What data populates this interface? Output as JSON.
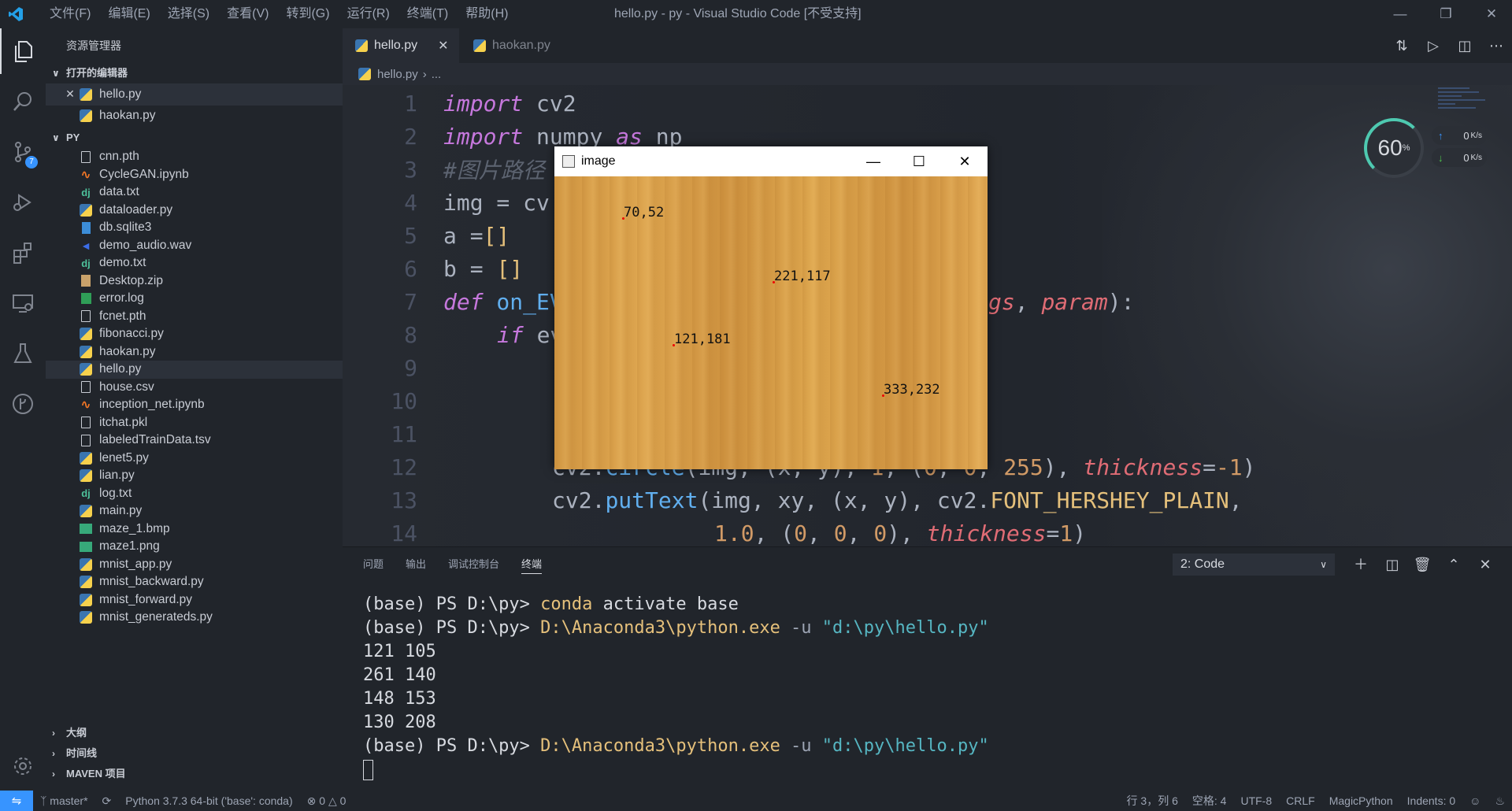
{
  "window": {
    "title": "hello.py - py - Visual Studio Code [不受支持]",
    "menu": [
      "文件(F)",
      "编辑(E)",
      "选择(S)",
      "查看(V)",
      "转到(G)",
      "运行(R)",
      "终端(T)",
      "帮助(H)"
    ],
    "logo_icon": "vscode-logo-icon"
  },
  "activity_bar": {
    "scm_badge": "7",
    "icons": [
      "explorer-icon",
      "search-icon",
      "source-control-icon",
      "run-debug-icon",
      "extensions-icon",
      "remote-explorer-icon",
      "testing-icon",
      "gitlens-icon",
      "settings-gear-icon"
    ]
  },
  "sidebar": {
    "title": "资源管理器",
    "open_editors": {
      "label": "打开的编辑器",
      "items": [
        "hello.py",
        "haokan.py"
      ]
    },
    "folder": {
      "label": "PY",
      "files": [
        {
          "name": "cnn.pth",
          "type": "doc"
        },
        {
          "name": "CycleGAN.ipynb",
          "type": "notebook"
        },
        {
          "name": "data.txt",
          "type": "dj"
        },
        {
          "name": "dataloader.py",
          "type": "py"
        },
        {
          "name": "db.sqlite3",
          "type": "db"
        },
        {
          "name": "demo_audio.wav",
          "type": "wav"
        },
        {
          "name": "demo.txt",
          "type": "dj"
        },
        {
          "name": "Desktop.zip",
          "type": "zip"
        },
        {
          "name": "error.log",
          "type": "log"
        },
        {
          "name": "fcnet.pth",
          "type": "doc"
        },
        {
          "name": "fibonacci.py",
          "type": "py"
        },
        {
          "name": "haokan.py",
          "type": "py"
        },
        {
          "name": "hello.py",
          "type": "py"
        },
        {
          "name": "house.csv",
          "type": "doc"
        },
        {
          "name": "inception_net.ipynb",
          "type": "notebook"
        },
        {
          "name": "itchat.pkl",
          "type": "doc"
        },
        {
          "name": "labeledTrainData.tsv",
          "type": "doc"
        },
        {
          "name": "lenet5.py",
          "type": "py"
        },
        {
          "name": "lian.py",
          "type": "py"
        },
        {
          "name": "log.txt",
          "type": "dj"
        },
        {
          "name": "main.py",
          "type": "py"
        },
        {
          "name": "maze_1.bmp",
          "type": "img"
        },
        {
          "name": "maze1.png",
          "type": "img"
        },
        {
          "name": "mnist_app.py",
          "type": "py"
        },
        {
          "name": "mnist_backward.py",
          "type": "py"
        },
        {
          "name": "mnist_forward.py",
          "type": "py"
        },
        {
          "name": "mnist_generateds.py",
          "type": "py"
        }
      ]
    },
    "outline_label": "大纲",
    "timeline_label": "时间线",
    "maven_label": "MAVEN 项目"
  },
  "tabs": [
    {
      "label": "hello.py",
      "active": true
    },
    {
      "label": "haokan.py",
      "active": false
    }
  ],
  "breadcrumb": {
    "file": "hello.py",
    "rest": "..."
  },
  "editor": {
    "line_numbers": [
      "1",
      "2",
      "3",
      "4",
      "5",
      "6",
      "7",
      "8",
      "9",
      "10",
      "11",
      "12",
      "13",
      "14"
    ],
    "visible_code": {
      "l1_kw": "import",
      "l1_rest": " cv2",
      "l2_kw": "import",
      "l2_mid": " numpy ",
      "l2_as": "as",
      "l2_rest": " np",
      "l3": "#图片路径",
      "l4": "img = cv",
      "l5_a": "a =",
      "l5_b": "[]",
      "l6_a": "b = ",
      "l6_b": "[]",
      "l7_kw": "def",
      "l7_fn": " on_EV",
      "l7_tail_par1": "gs",
      "l7_tail_mid": ", ",
      "l7_tail_par2": "param",
      "l7_tail_end": "):",
      "l8_kw": "if",
      "l8_rest": " ev",
      "l12_a": "cv2.",
      "l12_fn": "circle",
      "l12_b": "(img, (x, y), ",
      "l12_n1": "1",
      "l12_c": ", (",
      "l12_n2": "0",
      "l12_d": ", ",
      "l12_n3": "0",
      "l12_e": ", ",
      "l12_n4": "255",
      "l12_f": "), ",
      "l12_par": "thickness",
      "l12_g": "=",
      "l12_n5": "-1",
      "l12_h": ")",
      "l13_a": "cv2.",
      "l13_fn": "putText",
      "l13_b": "(img, xy, (x, y), cv2.",
      "l13_cls": "FONT_HERSHEY_PLAIN",
      "l13_c": ",",
      "l14_n1": "1.0",
      "l14_a": ", (",
      "l14_n2": "0",
      "l14_b": ", ",
      "l14_n3": "0",
      "l14_c": ", ",
      "l14_n4": "0",
      "l14_d": "), ",
      "l14_par": "thickness",
      "l14_e": "=",
      "l14_n5": "1",
      "l14_f": ")"
    }
  },
  "speed_widget": {
    "percent": "60",
    "percent_unit": "%",
    "upload": "0",
    "download": "0",
    "unit": "K/s"
  },
  "image_window": {
    "title": "image",
    "points": [
      {
        "label": "70,52"
      },
      {
        "label": "221,117"
      },
      {
        "label": "121,181"
      },
      {
        "label": "333,232"
      }
    ]
  },
  "panel": {
    "tabs": [
      "问题",
      "输出",
      "调试控制台",
      "终端"
    ],
    "active_tab": "终端",
    "terminal_select": "2: Code",
    "terminal": {
      "l1_prompt": "(base) PS D:\\py> ",
      "l1_cmd": "conda",
      "l1_rest": " activate base",
      "l2_prompt": "(base) PS D:\\py> ",
      "l2_cmd": "D:\\Anaconda3\\python.exe",
      "l2_flag": " -u ",
      "l2_str": "\"d:\\py\\hello.py\"",
      "out1": "121 105",
      "out2": "261 140",
      "out3": "148 153",
      "out4": "130 208",
      "l7_prompt": "(base) PS D:\\py> ",
      "l7_cmd": "D:\\Anaconda3\\python.exe",
      "l7_flag": " -u ",
      "l7_str": "\"d:\\py\\hello.py\""
    }
  },
  "status_bar": {
    "branch": "master*",
    "interpreter": "Python 3.7.3 64-bit ('base': conda)",
    "errors": "0",
    "warnings": "0",
    "position": "行 3，列 6",
    "spaces": "空格: 4",
    "encoding": "UTF-8",
    "eol": "CRLF",
    "language": "MagicPython",
    "indents": "Indents: 0"
  },
  "colors": {
    "accent": "#3794ff",
    "keyword": "#c678dd",
    "function": "#61afef"
  }
}
